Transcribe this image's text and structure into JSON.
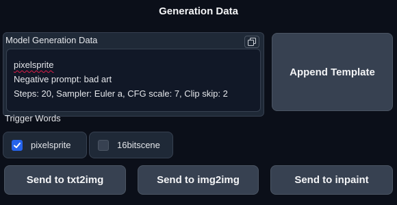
{
  "header": {
    "title": "Generation Data"
  },
  "model_data": {
    "label": "Model Generation Data",
    "lines": [
      "pixelsprite",
      "Negative prompt: bad art",
      "Steps: 20, Sampler: Euler a, CFG scale: 7, Clip skip: 2"
    ]
  },
  "append_button": {
    "label": "Append Template"
  },
  "trigger_words": {
    "label": "Trigger Words",
    "items": [
      {
        "label": "pixelsprite",
        "checked": true
      },
      {
        "label": "16bitscene",
        "checked": false
      }
    ]
  },
  "send_buttons": [
    {
      "label": "Send to txt2img"
    },
    {
      "label": "Send to img2img"
    },
    {
      "label": "Send to inpaint"
    }
  ],
  "colors": {
    "background": "#0b0f19",
    "panel": "#1f2937",
    "button": "#374151",
    "checkbox_accent": "#2563eb",
    "spellcheck": "#e11d48"
  }
}
